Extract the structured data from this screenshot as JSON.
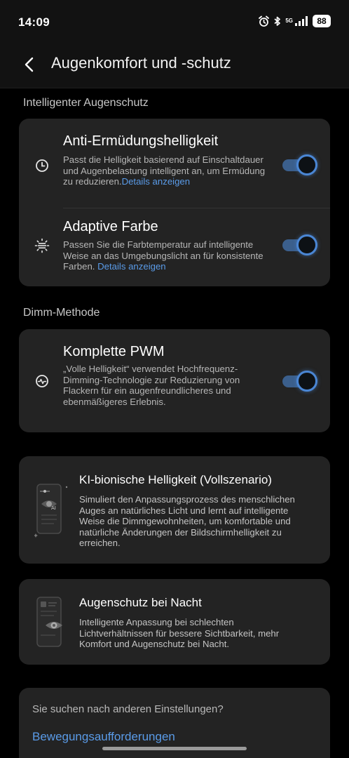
{
  "status_bar": {
    "time": "14:09",
    "network": "5G",
    "battery": "88",
    "icons": [
      "alarm-icon",
      "bluetooth-icon",
      "signal-icon",
      "battery-icon"
    ]
  },
  "header": {
    "title": "Augenkomfort und -schutz",
    "back_icon": "back-arrow-icon"
  },
  "sections": {
    "intelligent": {
      "label": "Intelligenter Augenschutz",
      "items": [
        {
          "title": "Anti-Ermüdungshelligkeit",
          "desc": "Passt die Helligkeit basierend auf Einschaltdauer und Augenbelastung intelligent an, um Ermüdung zu reduzieren.",
          "link": "Details anzeigen",
          "enabled": true,
          "icon": "clock-icon"
        },
        {
          "title": "Adaptive Farbe",
          "desc": "Passen Sie die Farbtemperatur auf intelligente Weise an das Umgebungslicht an für konsistente Farben.",
          "link": "Details anzeigen",
          "enabled": true,
          "icon": "sun-icon"
        }
      ]
    },
    "dimming": {
      "label": "Dimm-Methode",
      "items": [
        {
          "title": "Komplette PWM",
          "desc": "„Volle Helligkeit“ verwendet Hochfrequenz-Dimming-Technologie zur Reduzierung von Flackern für ein augenfreundlicheres und ebenmäßigeres Erlebnis.",
          "enabled": true,
          "icon": "wave-icon"
        }
      ]
    }
  },
  "features": [
    {
      "title": "KI-bionische Helligkeit (Vollszenario)",
      "desc": "Simuliert den Anpassungsprozess des menschlichen Auges an natürliches Licht und lernt auf intelligente Weise die Dimmgewohnheiten, um komfortable und natürliche Änderungen der Bildschirmhelligkeit zu erreichen.",
      "icon": "ai-eye-phone-icon"
    },
    {
      "title": "Augenschutz bei Nacht",
      "desc": "Intelligente Anpassung bei schlechten Lichtverhältnissen für bessere Sichtbarkeit, mehr Komfort und Augenschutz bei Nacht.",
      "icon": "night-eye-phone-icon"
    }
  ],
  "suggestions": {
    "question": "Sie suchen nach anderen Einstellungen?",
    "items": [
      "Bewegungsaufforderungen"
    ]
  },
  "colors": {
    "background": "#000000",
    "card": "#232323",
    "accent": "#4a86d4",
    "link": "#5a9be8"
  }
}
